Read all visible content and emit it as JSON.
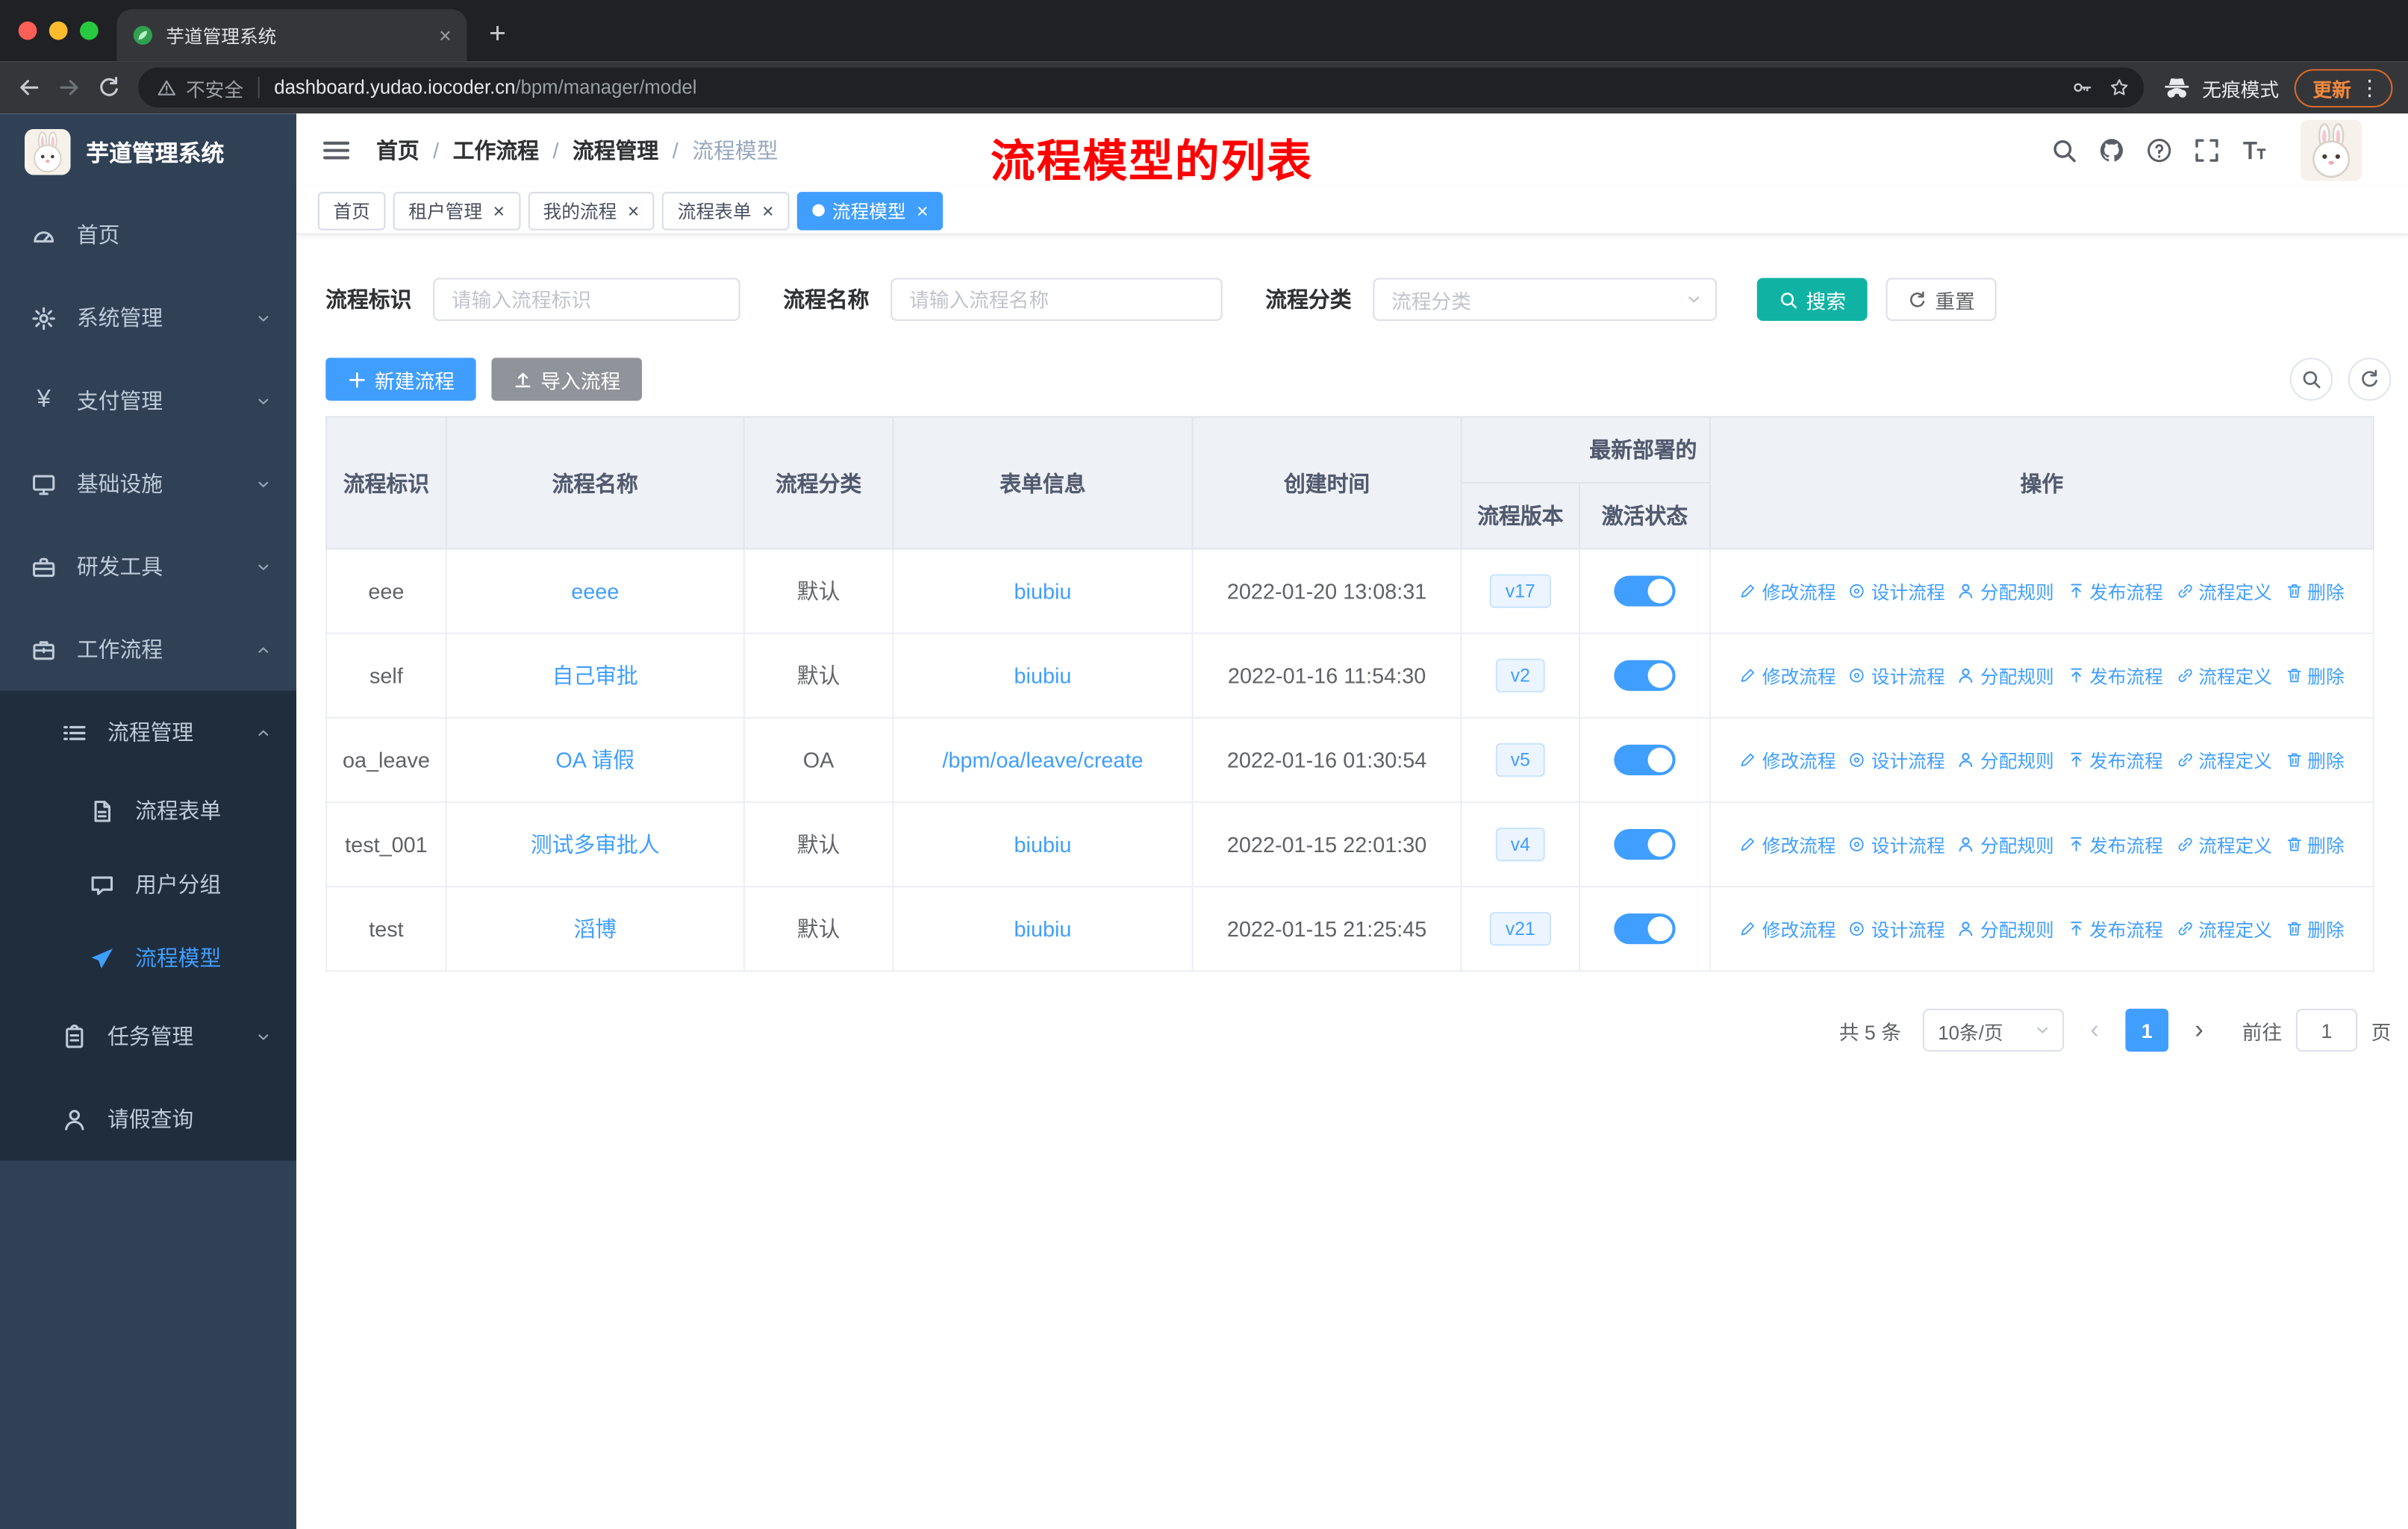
{
  "browser": {
    "tab_title": "芋道管理系统",
    "new_tab_label": "+",
    "security_text": "不安全",
    "url_host": "dashboard.yudao.iocoder.cn",
    "url_path": "/bpm/manager/model",
    "incognito_label": "无痕模式",
    "update_label": "更新"
  },
  "sidebar": {
    "logo_title": "芋道管理系统",
    "items": [
      {
        "name": "home",
        "label": "首页",
        "icon": "dashboard-icon",
        "level": 0
      },
      {
        "name": "system-management",
        "label": "系统管理",
        "icon": "gear-icon",
        "level": 0,
        "chevron": "down"
      },
      {
        "name": "payment-management",
        "label": "支付管理",
        "icon": "yen-icon",
        "level": 0,
        "chevron": "down"
      },
      {
        "name": "infrastructure",
        "label": "基础设施",
        "icon": "monitor-icon",
        "level": 0,
        "chevron": "down"
      },
      {
        "name": "dev-tools",
        "label": "研发工具",
        "icon": "toolbox-icon",
        "level": 0,
        "chevron": "down"
      },
      {
        "name": "workflow",
        "label": "工作流程",
        "icon": "briefcase-icon",
        "level": 0,
        "chevron": "up",
        "expanded": true
      },
      {
        "name": "process-management",
        "label": "流程管理",
        "icon": "list-icon",
        "level": 1,
        "sub": true,
        "chevron": "up",
        "expanded": true
      },
      {
        "name": "process-form",
        "label": "流程表单",
        "icon": "document-icon",
        "level": 2,
        "sub": true
      },
      {
        "name": "user-group",
        "label": "用户分组",
        "icon": "chat-icon",
        "level": 2,
        "sub": true
      },
      {
        "name": "process-model",
        "label": "流程模型",
        "icon": "paper-plane-icon",
        "level": 2,
        "sub": true,
        "active": true
      },
      {
        "name": "task-management",
        "label": "任务管理",
        "icon": "clipboard-icon",
        "level": 1,
        "sub": true,
        "chevron": "down"
      },
      {
        "name": "leave-query",
        "label": "请假查询",
        "icon": "user-icon",
        "level": 1,
        "sub": true
      }
    ]
  },
  "header": {
    "breadcrumb": [
      "首页",
      "工作流程",
      "流程管理",
      "流程模型"
    ],
    "annotation": "流程模型的列表"
  },
  "tags": [
    {
      "label": "首页",
      "closable": false,
      "active": false
    },
    {
      "label": "租户管理",
      "closable": true,
      "active": false
    },
    {
      "label": "我的流程",
      "closable": true,
      "active": false
    },
    {
      "label": "流程表单",
      "closable": true,
      "active": false
    },
    {
      "label": "流程模型",
      "closable": true,
      "active": true
    }
  ],
  "filters": {
    "fields": [
      {
        "label": "流程标识",
        "placeholder": "请输入流程标识",
        "type": "input"
      },
      {
        "label": "流程名称",
        "placeholder": "请输入流程名称",
        "type": "input"
      },
      {
        "label": "流程分类",
        "placeholder": "流程分类",
        "type": "select"
      }
    ],
    "search_label": "搜索",
    "reset_label": "重置"
  },
  "toolbar": {
    "create_label": "新建流程",
    "import_label": "导入流程"
  },
  "table": {
    "headers": {
      "id": "流程标识",
      "name": "流程名称",
      "category": "流程分类",
      "form": "表单信息",
      "created": "创建时间",
      "deploy_group": "最新部署的",
      "version": "流程版本",
      "active": "激活状态",
      "actions": "操作"
    },
    "rows": [
      {
        "id": "eee",
        "name": "eeee",
        "category": "默认",
        "form": "biubiu",
        "created": "2022-01-20 13:08:31",
        "version": "v17",
        "active": true
      },
      {
        "id": "self",
        "name": "自己审批",
        "category": "默认",
        "form": "biubiu",
        "created": "2022-01-16 11:54:30",
        "version": "v2",
        "active": true
      },
      {
        "id": "oa_leave",
        "name": "OA 请假",
        "category": "OA",
        "form": "/bpm/oa/leave/create",
        "created": "2022-01-16 01:30:54",
        "version": "v5",
        "active": true
      },
      {
        "id": "test_001",
        "name": "测试多审批人",
        "category": "默认",
        "form": "biubiu",
        "created": "2022-01-15 22:01:30",
        "version": "v4",
        "active": true
      },
      {
        "id": "test",
        "name": "滔博",
        "category": "默认",
        "form": "biubiu",
        "created": "2022-01-15 21:25:45",
        "version": "v21",
        "active": true
      }
    ],
    "row_actions": [
      {
        "name": "modify-process",
        "label": "修改流程",
        "icon": "edit-icon"
      },
      {
        "name": "design-process",
        "label": "设计流程",
        "icon": "design-icon"
      },
      {
        "name": "assign-rule",
        "label": "分配规则",
        "icon": "user-icon"
      },
      {
        "name": "publish-process",
        "label": "发布流程",
        "icon": "publish-icon"
      },
      {
        "name": "process-definition",
        "label": "流程定义",
        "icon": "link-icon"
      },
      {
        "name": "delete",
        "label": "删除",
        "icon": "trash-icon"
      }
    ]
  },
  "pagination": {
    "total_text": "共 5 条",
    "page_size": "10条/页",
    "prev_icon": "‹",
    "next_icon": "›",
    "current_page": "1",
    "goto_label": "前往",
    "goto_value": "1",
    "page_unit": "页"
  },
  "colors": {
    "primary": "#409eff",
    "search_button": "#10b3a3",
    "sidebar_bg": "#304156",
    "submenu_bg": "#1f2d3d",
    "annotation": "#ff0000",
    "import_button": "#909399"
  }
}
